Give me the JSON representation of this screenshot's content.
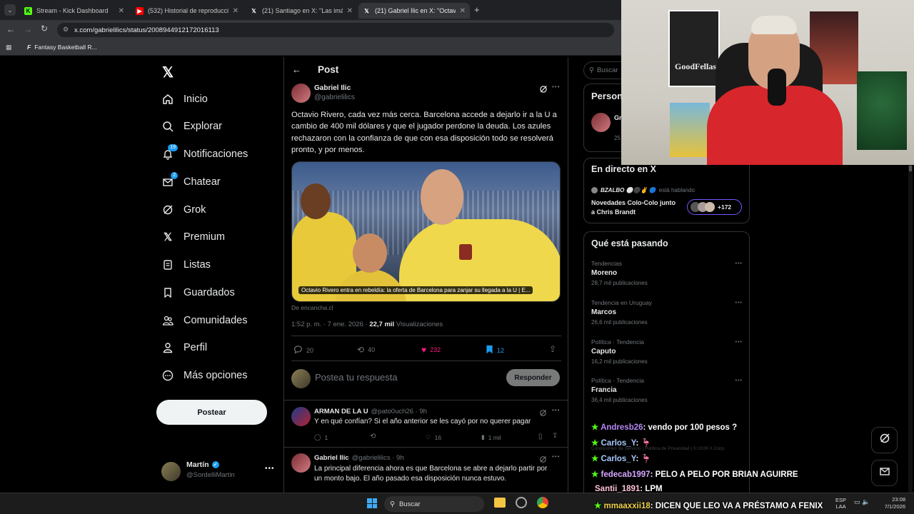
{
  "browser": {
    "tabs": [
      {
        "title": "Stream - Kick Dashboard",
        "icon": "kick-icon"
      },
      {
        "title": "(532) Historial de reproducción",
        "icon": "youtube-icon"
      },
      {
        "title": "(21) Santiago en X: \"Las imág",
        "icon": "x-icon"
      },
      {
        "title": "(21) Gabriel Ilic en X: \"Octavio",
        "icon": "x-icon"
      }
    ],
    "url": "x.com/gabrielilics/status/2008944912172016113",
    "bookmark": "Fantasy Basketball R..."
  },
  "nav": {
    "items": [
      {
        "label": "Inicio",
        "icon": "home-icon"
      },
      {
        "label": "Explorar",
        "icon": "search-icon"
      },
      {
        "label": "Notificaciones",
        "icon": "bell-icon",
        "badge": "19"
      },
      {
        "label": "Chatear",
        "icon": "mail-icon",
        "badge": "2"
      },
      {
        "label": "Grok",
        "icon": "grok-icon"
      },
      {
        "label": "Premium",
        "icon": "x-logo-icon"
      },
      {
        "label": "Listas",
        "icon": "list-icon"
      },
      {
        "label": "Guardados",
        "icon": "bookmark-icon"
      },
      {
        "label": "Comunidades",
        "icon": "people-icon"
      },
      {
        "label": "Perfil",
        "icon": "person-icon"
      },
      {
        "label": "Más opciones",
        "icon": "more-circle-icon"
      }
    ],
    "post_button": "Postear",
    "account": {
      "name": "Martín",
      "handle": "@SordelliMartin"
    }
  },
  "post": {
    "header": "Post",
    "author": "Gabriel Ilic",
    "handle": "@gabrielilics",
    "text": "Octavio Rivero, cada vez más cerca. Barcelona accede a dejarlo ir a la U a cambio de 400 mil dólares y que el jugador perdone la deuda. Los azules rechazaron con la confianza de que con esa disposición todo se resolverá pronto, y por menos.",
    "card_caption": "Octavio Rivero entra en rebeldía: la oferta de Barcelona para zanjar su llegada a la U | E...",
    "card_source": "De encancha.cl",
    "time": "1:52 p. m. · 7 ene. 2026 · ",
    "views": "22,7 mil",
    "views_label": " Visualizaciones",
    "replies": "20",
    "reposts": "40",
    "likes": "232",
    "bookmarks": "12",
    "reply_placeholder": "Postea tu respuesta",
    "reply_button": "Responder"
  },
  "replies": [
    {
      "author": "ARMAN DE LA U",
      "handle": "@pato0uch26 · 9h",
      "text": "Y en qué confían? Si el año anterior se les cayó por no querer pagar",
      "r": "1",
      "rt": "",
      "l": "16",
      "v": "1 mil"
    },
    {
      "author": "Gabriel Ilic",
      "handle": "@gabrielilics · 9h",
      "text": "La principal diferencia ahora es que Barcelona se abre a dejarlo partir por un monto bajo. El año pasado esa disposición nunca estuvo."
    }
  ],
  "right": {
    "search_placeholder": "Buscar",
    "persons_title": "Person",
    "persons_partial": "Gr",
    "persons_count": "25",
    "live_title": "En directo en X",
    "live_host": "BZALBO ⚪⚫✌ 🔵",
    "live_status": "está hablando",
    "live_topic": "Novedades Colo-Colo junto a Chris Brandt",
    "live_count": "+172",
    "trends_title": "Qué está pasando",
    "trends": [
      {
        "cat": "Tendencias",
        "name": "Moreno",
        "count": "28,7 mil publicaciones"
      },
      {
        "cat": "Tendencia en Uruguay",
        "name": "Marcos",
        "count": "26,6 mil publicaciones"
      },
      {
        "cat": "Política · Tendencia",
        "name": "Caputo",
        "count": "16,2 mil publicaciones"
      },
      {
        "cat": "Política · Tendencia",
        "name": "Francia",
        "count": "36,4 mil publicaciones"
      }
    ],
    "footer": "Condiciones de Servicio | Política de Privacidad | © 2026 X Corp."
  },
  "chat": [
    {
      "user": "Andresb26",
      "color": "#b586f2",
      "msg": ": vendo por 100 pesos ?"
    },
    {
      "user": "Carlos_Y",
      "color": "#a7c7ff",
      "msg": ": 🦩"
    },
    {
      "user": "Carlos_Y",
      "color": "#a7c7ff",
      "msg": ": 🦩"
    },
    {
      "user": "fedecab1997",
      "color": "#d9a7ff",
      "msg": ": PELO A PELO POR BRIAN AGUIRRE"
    },
    {
      "user": "Santii_1891",
      "color": "#ffc2d6",
      "msg": ": LPM"
    },
    {
      "user": "mmaaxxii18",
      "color": "#f2d34b",
      "msg": ": DICEN QUE LEO VA A PRÉSTAMO A FENIX"
    }
  ],
  "taskbar": {
    "search": "Buscar",
    "lang": "ESP",
    "lang2": "LAA",
    "time": "23:08",
    "date": "7/1/2026"
  },
  "colors": {
    "accent": "#1d9bf0",
    "like": "#f91880",
    "background": "#000000"
  }
}
